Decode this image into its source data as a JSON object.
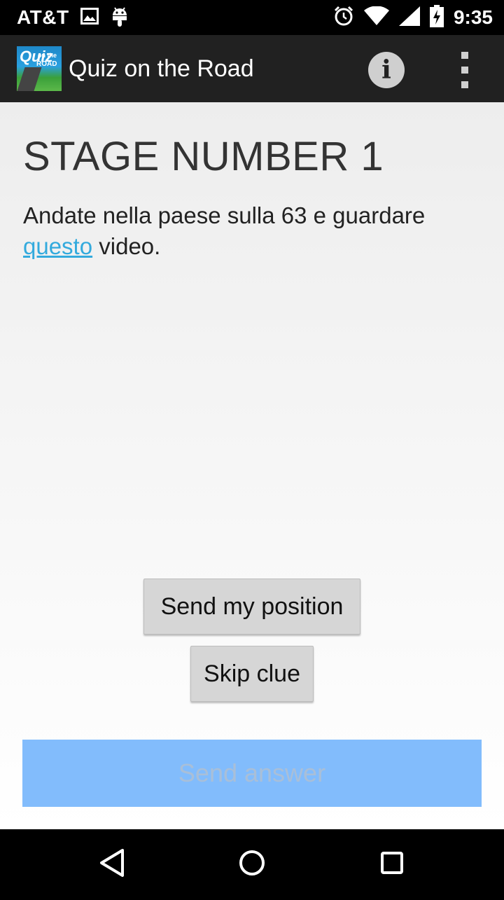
{
  "status_bar": {
    "carrier": "AT&T",
    "time": "9:35",
    "icons": [
      "image-icon",
      "android-icon",
      "alarm-icon",
      "wifi-icon",
      "signal-icon",
      "battery-charging-icon"
    ]
  },
  "action_bar": {
    "app_icon": "quiz-on-the-road-logo",
    "app_icon_text": {
      "q": "Quiz",
      "t1": "on the",
      "t2": "ROAD"
    },
    "title": "Quiz on the Road",
    "info_icon": "info-icon",
    "overflow_icon": "overflow-menu-icon"
  },
  "stage": {
    "title": "STAGE NUMBER 1",
    "clue_before": "Andate nella paese sulla 63 e guardare ",
    "clue_link": "questo",
    "clue_after": " video."
  },
  "buttons": {
    "send_position": "Send my position",
    "skip_clue": "Skip clue",
    "send_answer": "Send answer"
  },
  "nav_bar": {
    "icons": [
      "back-icon",
      "home-icon",
      "recents-icon"
    ]
  },
  "colors": {
    "action_bar": "#212121",
    "link": "#33aadd",
    "send_answer_bg": "#82bcfc",
    "button_bg": "#d6d6d6"
  }
}
